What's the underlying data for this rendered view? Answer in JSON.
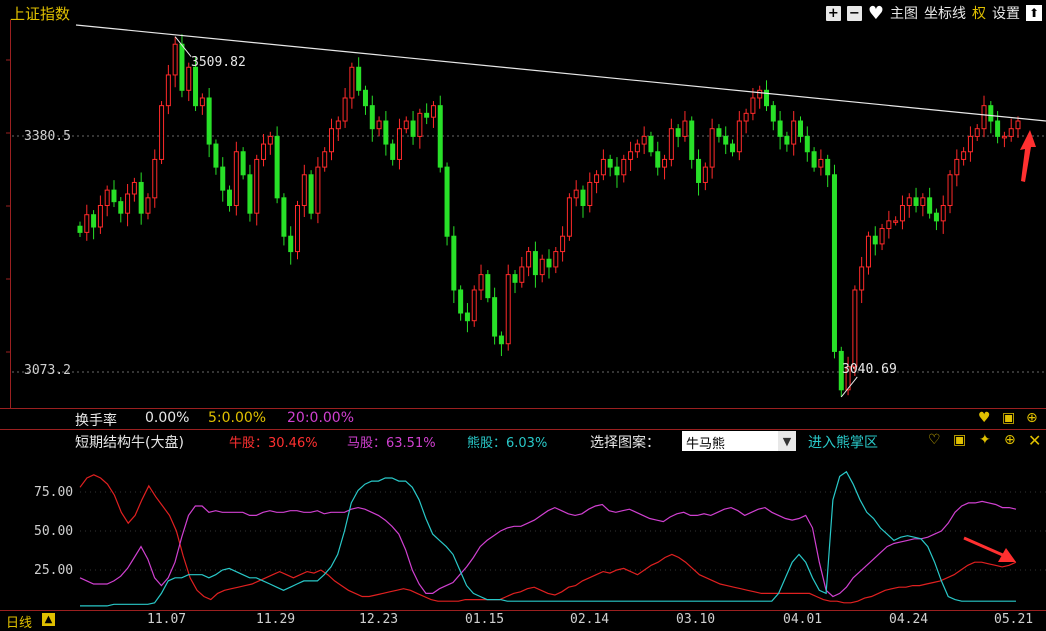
{
  "title": "上证指数",
  "toolbar": {
    "plus": "+",
    "minus": "−",
    "heart": "♥",
    "main_chart": "主图",
    "axis_line": "坐标线",
    "quan": "权",
    "settings": "设置",
    "up": "⬆"
  },
  "y_labels": {
    "upper": "3380.5",
    "lower": "3073.2"
  },
  "annotations": {
    "high": "3509.82",
    "low": "3040.69"
  },
  "colors": {
    "up": "#ff2a2a",
    "down": "#28e028",
    "cyan": "#29c8c8",
    "magenta": "#d040d0",
    "gold": "#e0c000"
  },
  "turnover": {
    "label": "换手率",
    "value": "0.00%",
    "ma5": "5:0.00%",
    "ma20": "20:0.00%"
  },
  "indicator": {
    "name": "短期结构牛(大盘)",
    "bull": "牛股：30.46%",
    "horse": "马股：63.51%",
    "bear": "熊股：6.03%",
    "select_label": "选择图案：",
    "select_value": "牛马熊",
    "zone": "进入熊掌区",
    "y_ticks": [
      "75.00",
      "50.00",
      "25.00"
    ]
  },
  "dates": [
    "11.07",
    "11.29",
    "12.23",
    "01.15",
    "02.14",
    "03.10",
    "04.01",
    "04.24",
    "05.21"
  ],
  "period": "日线",
  "chart_data": {
    "type": "candlestick",
    "title": "上证指数",
    "high_marker": 3509.82,
    "low_marker": 3040.69,
    "y_ticks": [
      3380.5,
      3073.2
    ],
    "closes": [
      3255,
      3278,
      3262,
      3290,
      3310,
      3295,
      3280,
      3305,
      3320,
      3280,
      3300,
      3350,
      3420,
      3460,
      3500,
      3440,
      3470,
      3420,
      3430,
      3370,
      3340,
      3310,
      3290,
      3360,
      3330,
      3280,
      3350,
      3370,
      3380,
      3300,
      3250,
      3230,
      3290,
      3330,
      3280,
      3340,
      3360,
      3390,
      3400,
      3430,
      3470,
      3440,
      3420,
      3390,
      3400,
      3370,
      3350,
      3390,
      3400,
      3380,
      3410,
      3405,
      3420,
      3340,
      3250,
      3180,
      3150,
      3140,
      3180,
      3200,
      3170,
      3120,
      3110,
      3200,
      3190,
      3210,
      3230,
      3200,
      3220,
      3210,
      3230,
      3250,
      3300,
      3310,
      3290,
      3320,
      3330,
      3350,
      3340,
      3330,
      3350,
      3360,
      3370,
      3380,
      3360,
      3340,
      3350,
      3390,
      3380,
      3400,
      3350,
      3320,
      3340,
      3390,
      3380,
      3370,
      3360,
      3400,
      3410,
      3430,
      3440,
      3420,
      3400,
      3380,
      3370,
      3400,
      3380,
      3360,
      3340,
      3350,
      3330,
      3100,
      3050,
      3080,
      3180,
      3210,
      3250,
      3240,
      3260,
      3270,
      3270,
      3290,
      3300,
      3290,
      3300,
      3280,
      3270,
      3290,
      3330,
      3350,
      3360,
      3380,
      3390,
      3420,
      3400,
      3380,
      3380,
      3390,
      3400
    ],
    "turnover": {
      "label": "换手率",
      "value": 0.0,
      "ma5": 0.0,
      "ma20": 0.0
    },
    "indicator_series": [
      {
        "name": "牛股",
        "latest": 30.46
      },
      {
        "name": "马股",
        "latest": 63.51
      },
      {
        "name": "熊股",
        "latest": 6.03
      }
    ],
    "indicator_ticks": [
      75,
      50,
      25
    ],
    "bull": [
      78,
      84,
      86,
      84,
      80,
      73,
      62,
      55,
      60,
      70,
      79,
      72,
      66,
      60,
      50,
      34,
      20,
      12,
      8,
      6,
      10,
      12,
      13,
      14,
      15,
      16,
      18,
      20,
      22,
      24,
      22,
      20,
      22,
      24,
      23,
      25,
      22,
      18,
      15,
      12,
      10,
      8,
      8,
      9,
      10,
      11,
      12,
      13,
      12,
      10,
      8,
      6,
      5,
      5,
      5,
      5,
      6,
      6,
      6,
      6,
      6,
      6,
      8,
      10,
      11,
      13,
      14,
      12,
      10,
      9,
      11,
      14,
      15,
      18,
      20,
      22,
      24,
      23,
      25,
      26,
      24,
      22,
      25,
      28,
      30,
      33,
      35,
      33,
      30,
      26,
      22,
      20,
      18,
      16,
      15,
      14,
      13,
      12,
      11,
      10,
      10,
      10,
      10,
      10,
      10,
      10,
      10,
      8,
      6,
      5,
      5,
      4,
      4,
      5,
      7,
      8,
      10,
      12,
      13,
      14,
      14,
      15,
      15,
      16,
      17,
      18,
      20,
      22,
      25,
      28,
      30,
      30,
      29,
      28,
      27,
      28,
      30
    ],
    "horse": [
      20,
      18,
      16,
      16,
      16,
      18,
      21,
      26,
      33,
      40,
      32,
      20,
      15,
      20,
      30,
      46,
      60,
      66,
      66,
      62,
      63,
      62,
      62,
      62,
      62,
      60,
      60,
      62,
      63,
      62,
      62,
      63,
      63,
      62,
      62,
      63,
      61,
      62,
      62,
      62,
      64,
      65,
      64,
      62,
      60,
      57,
      53,
      48,
      38,
      25,
      16,
      10,
      10,
      13,
      15,
      17,
      22,
      27,
      33,
      40,
      44,
      47,
      50,
      52,
      53,
      53,
      55,
      57,
      60,
      63,
      65,
      63,
      61,
      60,
      61,
      64,
      66,
      67,
      63,
      62,
      63,
      64,
      62,
      60,
      58,
      57,
      56,
      59,
      61,
      62,
      60,
      60,
      61,
      60,
      62,
      64,
      65,
      63,
      60,
      62,
      64,
      65,
      62,
      60,
      58,
      57,
      58,
      60,
      52,
      30,
      12,
      8,
      10,
      14,
      20,
      24,
      28,
      32,
      36,
      40,
      42,
      43,
      44,
      45,
      45,
      46,
      48,
      50,
      55,
      62,
      66,
      68,
      68,
      69,
      68,
      67,
      65,
      65,
      64
    ],
    "bear": [
      2,
      2,
      2,
      2,
      2,
      3,
      3,
      3,
      3,
      3,
      3,
      4,
      10,
      18,
      20,
      20,
      22,
      22,
      22,
      20,
      22,
      25,
      26,
      24,
      22,
      20,
      20,
      18,
      16,
      14,
      12,
      14,
      16,
      18,
      18,
      18,
      22,
      27,
      35,
      50,
      68,
      76,
      80,
      82,
      82,
      84,
      84,
      82,
      82,
      78,
      70,
      58,
      48,
      44,
      40,
      35,
      25,
      15,
      10,
      8,
      6,
      6,
      6,
      5,
      5,
      5,
      5,
      5,
      5,
      5,
      5,
      5,
      5,
      5,
      5,
      5,
      5,
      5,
      5,
      5,
      5,
      5,
      5,
      5,
      5,
      5,
      5,
      5,
      5,
      5,
      5,
      5,
      5,
      5,
      5,
      5,
      5,
      5,
      5,
      5,
      5,
      5,
      5,
      10,
      20,
      30,
      35,
      30,
      20,
      12,
      10,
      70,
      85,
      88,
      80,
      70,
      62,
      58,
      52,
      48,
      44,
      46,
      47,
      46,
      45,
      40,
      30,
      18,
      8,
      6,
      5,
      5,
      5,
      5,
      5,
      5,
      5,
      5,
      5
    ]
  }
}
